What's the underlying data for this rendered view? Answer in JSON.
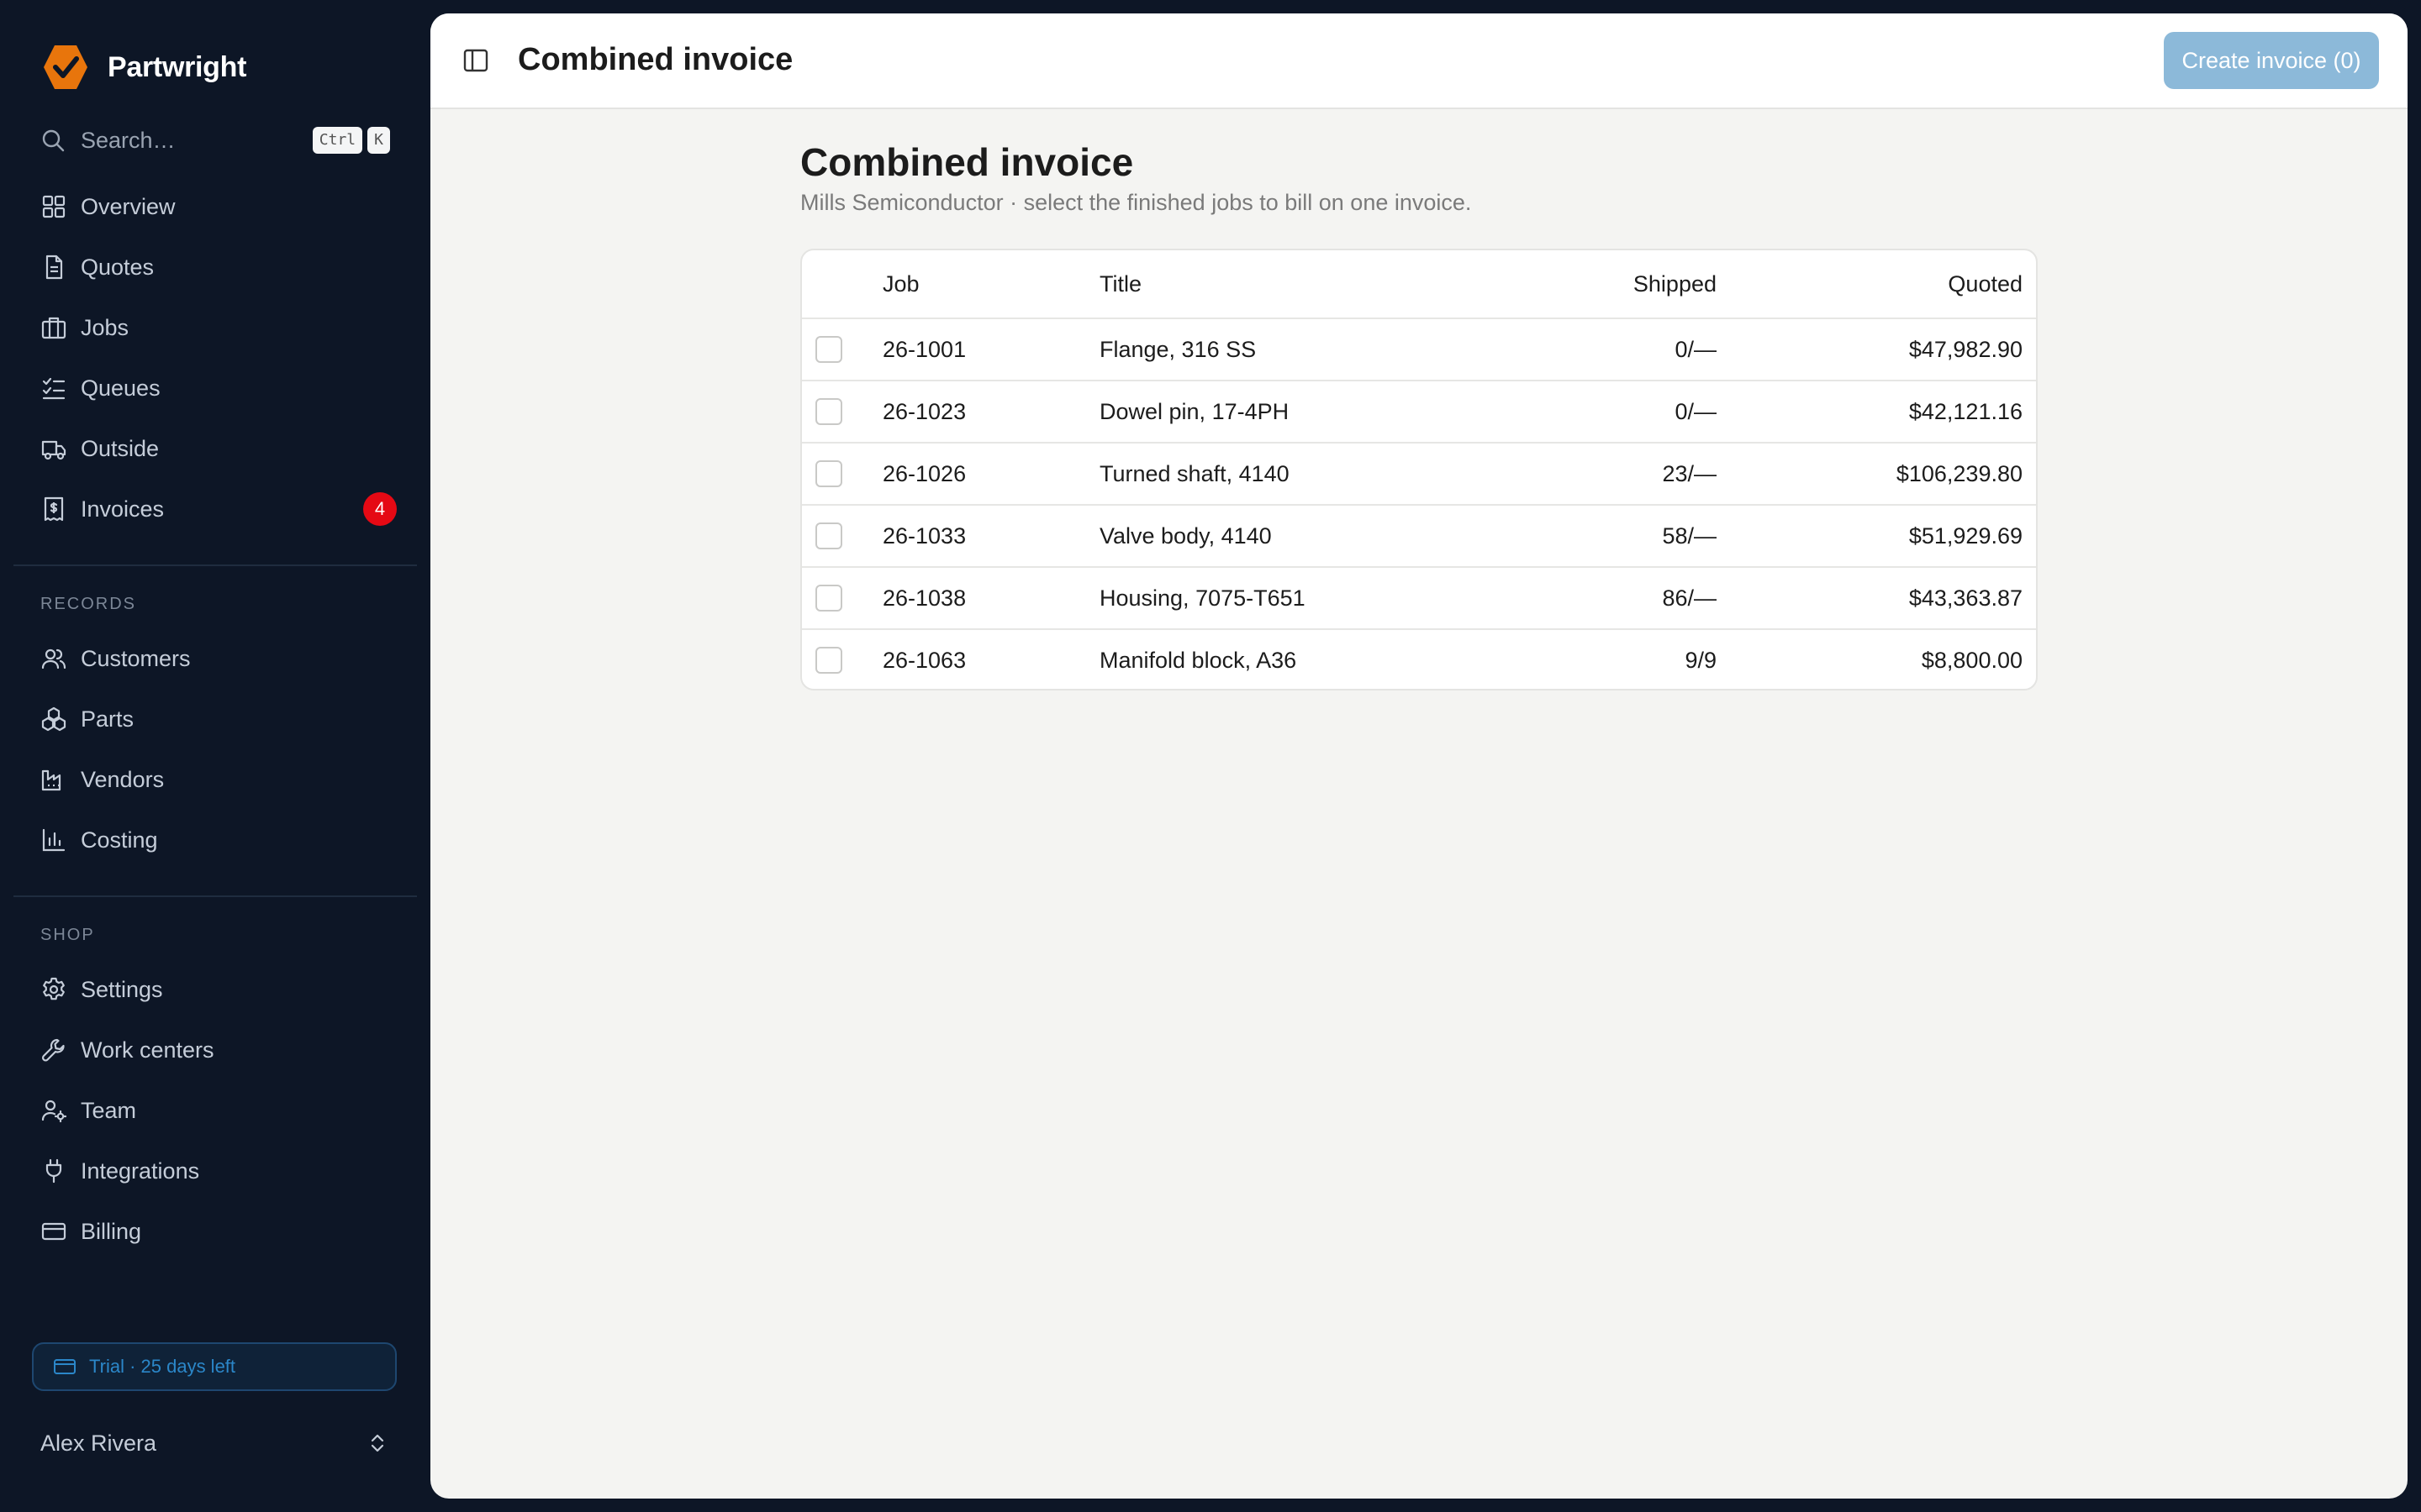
{
  "app": {
    "brand_name": "Partwright",
    "accent_color": "#e8750c"
  },
  "search": {
    "placeholder": "Search…",
    "shortcut_keys": [
      "Ctrl",
      "K"
    ]
  },
  "sidebar": {
    "main_items": [
      {
        "label": "Overview",
        "icon": "grid-icon"
      },
      {
        "label": "Quotes",
        "icon": "document-icon"
      },
      {
        "label": "Jobs",
        "icon": "briefcase-icon"
      },
      {
        "label": "Queues",
        "icon": "checklist-icon"
      },
      {
        "label": "Outside",
        "icon": "truck-icon"
      },
      {
        "label": "Invoices",
        "icon": "receipt-dollar-icon",
        "badge": "4"
      }
    ],
    "records_label": "RECORDS",
    "records_items": [
      {
        "label": "Customers",
        "icon": "users-icon"
      },
      {
        "label": "Parts",
        "icon": "boxes-icon"
      },
      {
        "label": "Vendors",
        "icon": "factory-icon"
      },
      {
        "label": "Costing",
        "icon": "bar-chart-icon"
      }
    ],
    "shop_label": "SHOP",
    "shop_items": [
      {
        "label": "Settings",
        "icon": "gear-icon"
      },
      {
        "label": "Work centers",
        "icon": "wrench-icon"
      },
      {
        "label": "Team",
        "icon": "user-gear-icon"
      },
      {
        "label": "Integrations",
        "icon": "plug-icon"
      },
      {
        "label": "Billing",
        "icon": "credit-card-icon"
      }
    ],
    "trial_text": "Trial · 25 days left",
    "user_name": "Alex Rivera"
  },
  "topbar": {
    "title": "Combined invoice",
    "create_button": "Create invoice (0)"
  },
  "page": {
    "title": "Combined invoice",
    "subtitle": "Mills Semiconductor · select the finished jobs to bill on one invoice."
  },
  "table": {
    "columns": [
      "Job",
      "Title",
      "Shipped",
      "Quoted"
    ],
    "rows": [
      {
        "job": "26-1001",
        "title": "Flange, 316 SS",
        "shipped": "0/—",
        "quoted": "$47,982.90"
      },
      {
        "job": "26-1023",
        "title": "Dowel pin, 17-4PH",
        "shipped": "0/—",
        "quoted": "$42,121.16"
      },
      {
        "job": "26-1026",
        "title": "Turned shaft, 4140",
        "shipped": "23/—",
        "quoted": "$106,239.80"
      },
      {
        "job": "26-1033",
        "title": "Valve body, 4140",
        "shipped": "58/—",
        "quoted": "$51,929.69"
      },
      {
        "job": "26-1038",
        "title": "Housing, 7075-T651",
        "shipped": "86/—",
        "quoted": "$43,363.87"
      },
      {
        "job": "26-1063",
        "title": "Manifold block, A36",
        "shipped": "9/9",
        "quoted": "$8,800.00"
      }
    ]
  }
}
